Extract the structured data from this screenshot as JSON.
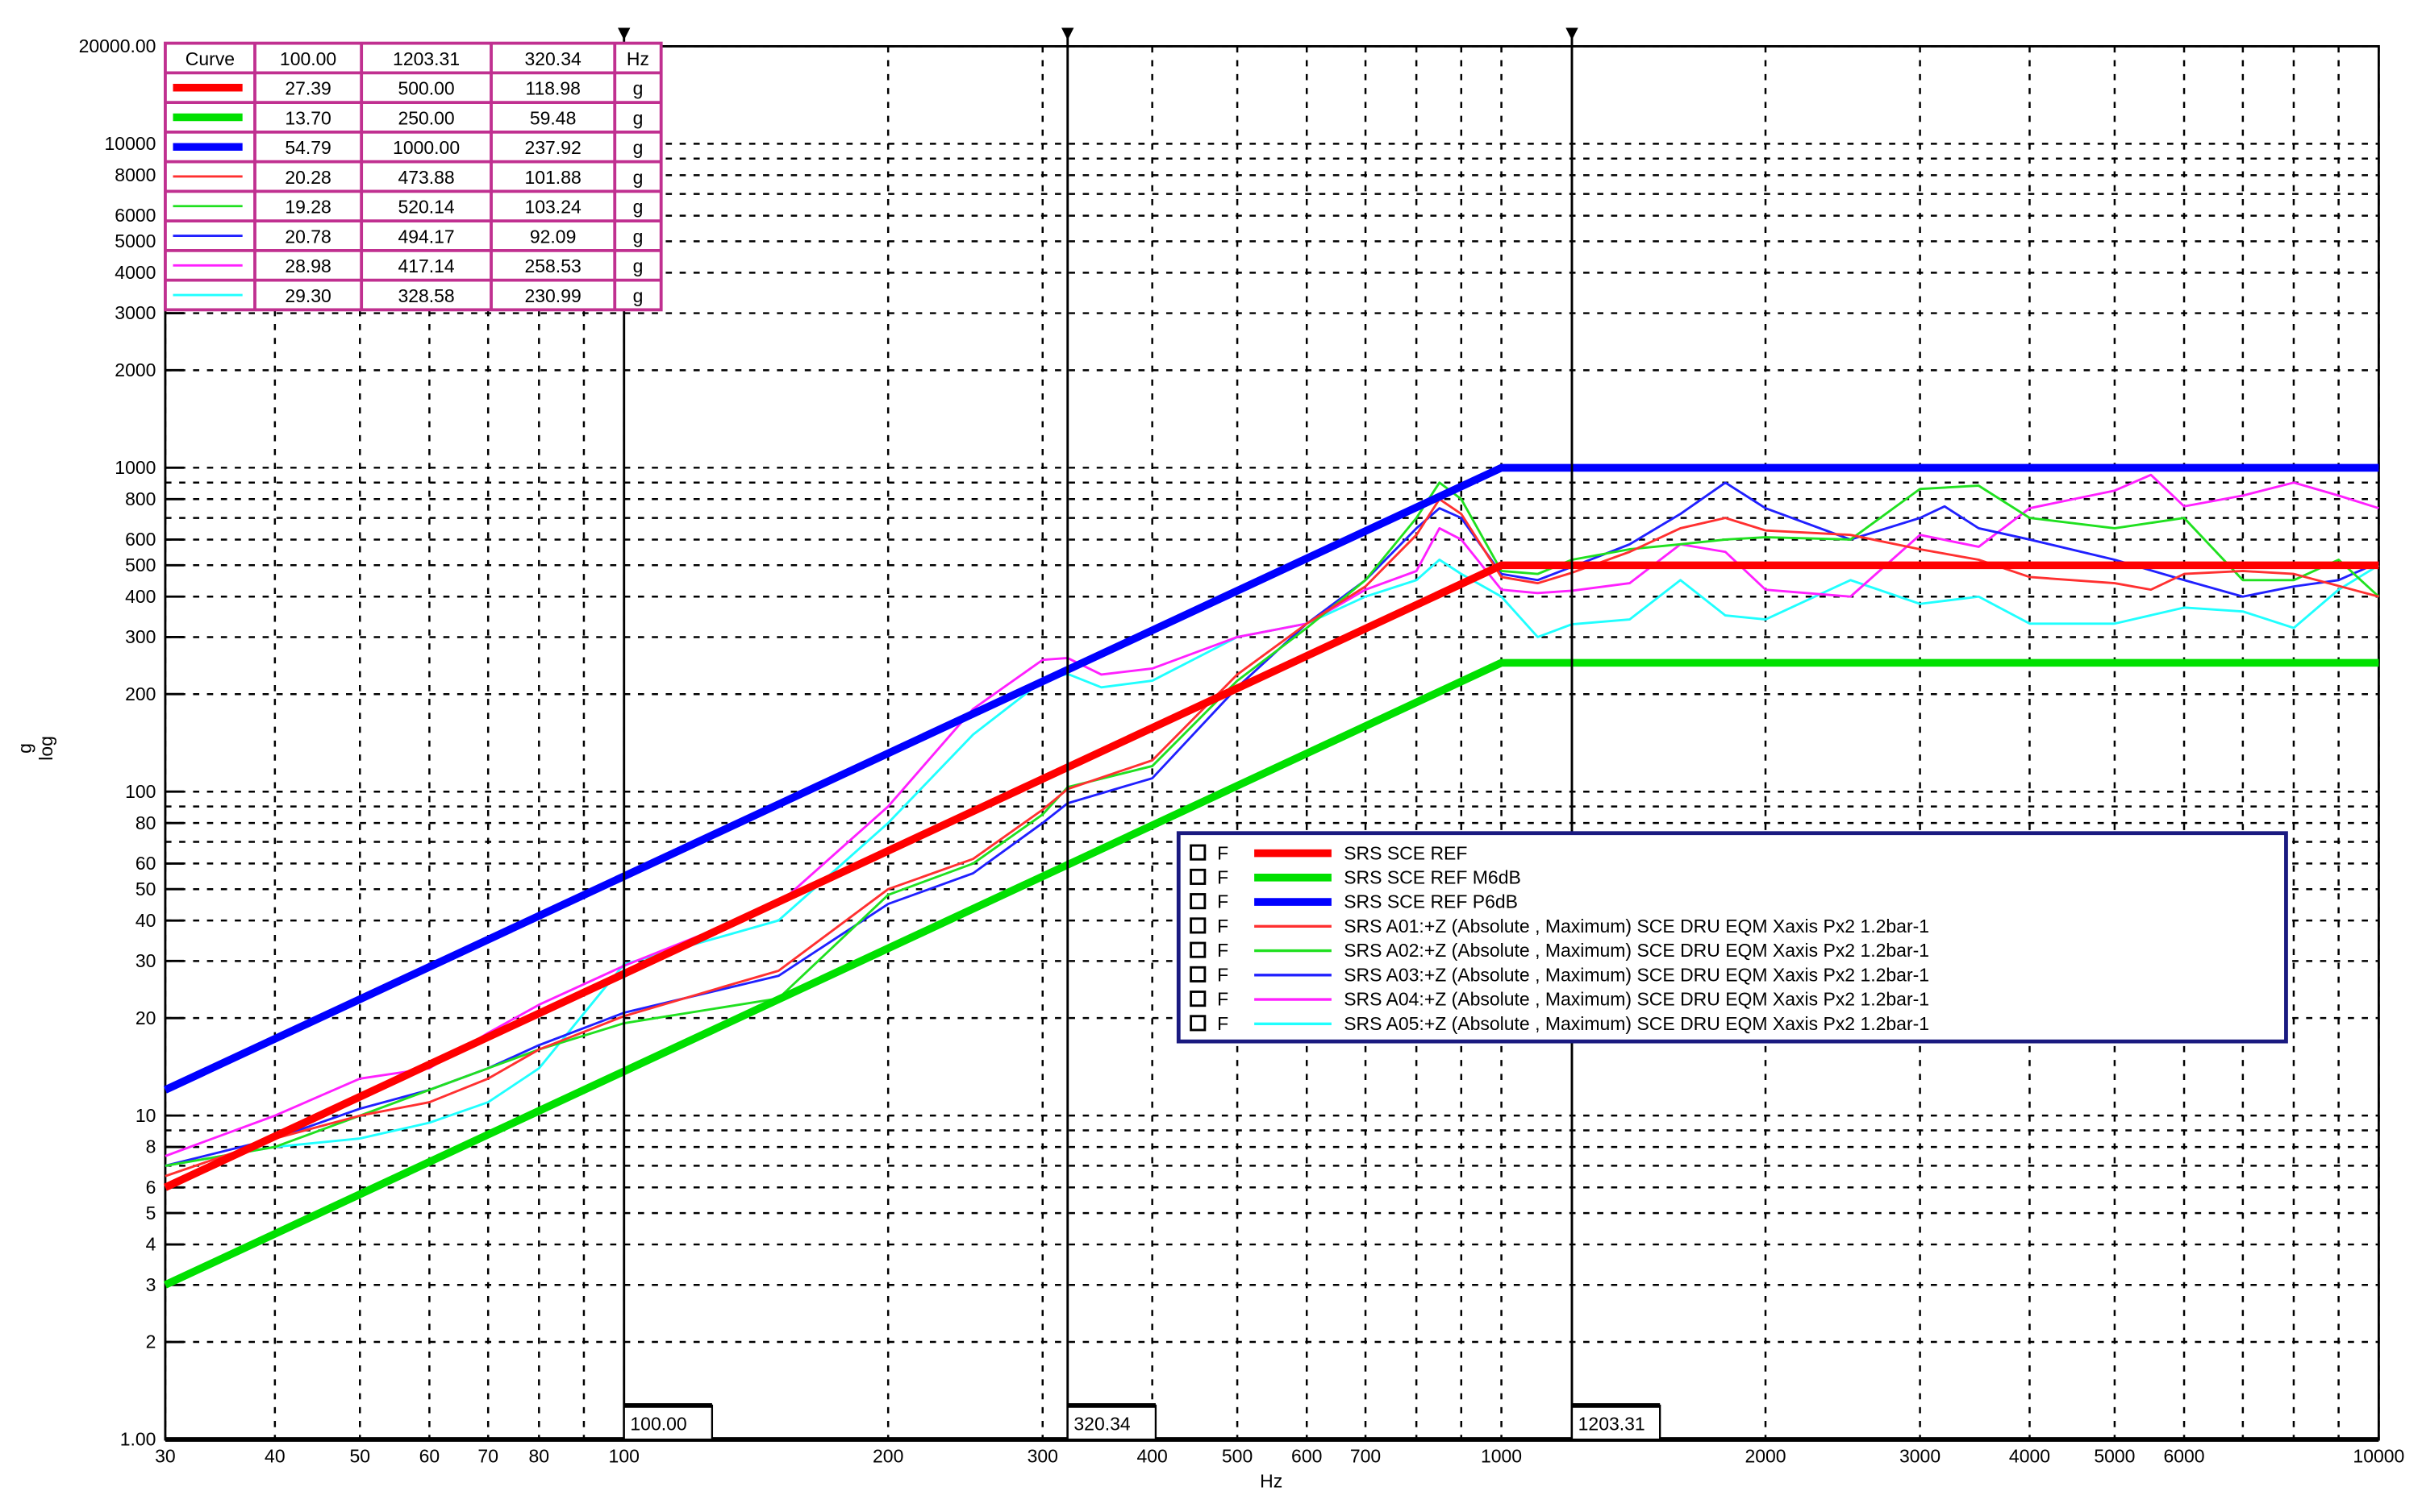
{
  "chart_data": {
    "type": "line",
    "xscale": "log",
    "yscale": "log",
    "xlim": [
      30,
      10000
    ],
    "ylim": [
      1,
      20000
    ],
    "xlabel": "Hz",
    "ylabel": "g",
    "ylabel_sub": "log",
    "grid": true,
    "x_ticks": [
      30,
      40,
      50,
      60,
      70,
      80,
      100,
      200,
      300,
      400,
      500,
      600,
      700,
      1000,
      2000,
      3000,
      4000,
      5000,
      6000,
      10000
    ],
    "x_tick_labels": [
      "30",
      "40",
      "50",
      "60",
      "70",
      "80",
      "100",
      "200",
      "300",
      "400",
      "500",
      "600",
      "700",
      "1000",
      "2000",
      "3000",
      "4000",
      "5000",
      "6000",
      "10000"
    ],
    "y_ticks": [
      1,
      2,
      3,
      4,
      5,
      6,
      8,
      10,
      20,
      30,
      40,
      50,
      60,
      80,
      100,
      200,
      300,
      400,
      500,
      600,
      800,
      1000,
      2000,
      3000,
      4000,
      5000,
      6000,
      8000,
      10000,
      20000
    ],
    "y_tick_labels": [
      "1.00",
      "2",
      "3",
      "4",
      "5",
      "6",
      "8",
      "10",
      "20",
      "30",
      "40",
      "50",
      "60",
      "80",
      "100",
      "200",
      "300",
      "400",
      "500",
      "600",
      "800",
      "1000",
      "2000",
      "3000",
      "4000",
      "5000",
      "6000",
      "8000",
      "10000",
      "20000.00"
    ],
    "cursors": [
      {
        "freq": 100.0,
        "label": "100.00"
      },
      {
        "freq": 320.34,
        "label": "320.34"
      },
      {
        "freq": 1203.31,
        "label": "1203.31"
      }
    ],
    "cursor_table": {
      "header": [
        "Curve",
        "100.00",
        "1203.31",
        "320.34",
        "Hz"
      ],
      "rows": [
        {
          "color": "#ff0000",
          "thick": true,
          "values": [
            "27.39",
            "500.00",
            "118.98"
          ],
          "unit": "g"
        },
        {
          "color": "#00e000",
          "thick": true,
          "values": [
            "13.70",
            "250.00",
            "59.48"
          ],
          "unit": "g"
        },
        {
          "color": "#0000ff",
          "thick": true,
          "values": [
            "54.79",
            "1000.00",
            "237.92"
          ],
          "unit": "g"
        },
        {
          "color": "#ff3030",
          "thick": false,
          "values": [
            "20.28",
            "473.88",
            "101.88"
          ],
          "unit": "g"
        },
        {
          "color": "#20e020",
          "thick": false,
          "values": [
            "19.28",
            "520.14",
            "103.24"
          ],
          "unit": "g"
        },
        {
          "color": "#2020ff",
          "thick": false,
          "values": [
            "20.78",
            "494.17",
            "92.09"
          ],
          "unit": "g"
        },
        {
          "color": "#ff20ff",
          "thick": false,
          "values": [
            "28.98",
            "417.14",
            "258.53"
          ],
          "unit": "g"
        },
        {
          "color": "#20ffff",
          "thick": false,
          "values": [
            "29.30",
            "328.58",
            "230.99"
          ],
          "unit": "g"
        }
      ]
    },
    "series": [
      {
        "name": "SRS  SCE REF",
        "flag": "F",
        "color": "#ff0000",
        "thick": true,
        "x": [
          30,
          1000,
          10000
        ],
        "y": [
          6.0,
          500,
          500
        ]
      },
      {
        "name": "SRS  SCE REF M6dB",
        "flag": "F",
        "color": "#00e000",
        "thick": true,
        "x": [
          30,
          1000,
          10000
        ],
        "y": [
          3.0,
          250,
          250
        ]
      },
      {
        "name": "SRS  SCE REF P6dB",
        "flag": "F",
        "color": "#0000ff",
        "thick": true,
        "x": [
          30,
          1000,
          10000
        ],
        "y": [
          12.0,
          1000,
          1000
        ]
      },
      {
        "name": "SRS  A01:+Z (Absolute , Maximum)  SCE DRU EQM Xaxis Px2 1.2bar-1",
        "flag": "F",
        "color": "#ff3030",
        "thick": false,
        "x": [
          30,
          40,
          50,
          60,
          70,
          80,
          100,
          130,
          150,
          200,
          250,
          300,
          320.34,
          400,
          500,
          600,
          700,
          800,
          850,
          900,
          1000,
          1100,
          1203.31,
          1400,
          1600,
          1800,
          2000,
          2500,
          3000,
          3500,
          4000,
          5000,
          5500,
          6000,
          7000,
          8000,
          10000
        ],
        "y": [
          6.5,
          8.5,
          10,
          11,
          13,
          16,
          20.28,
          25,
          28,
          50,
          62,
          88,
          101.88,
          125,
          230,
          330,
          430,
          620,
          800,
          720,
          460,
          440,
          473.88,
          550,
          650,
          700,
          640,
          620,
          560,
          520,
          460,
          440,
          420,
          470,
          480,
          470,
          400
        ]
      },
      {
        "name": "SRS  A02:+Z (Absolute , Maximum)  SCE DRU EQM Xaxis Px2 1.2bar-1",
        "flag": "F",
        "color": "#20e020",
        "thick": false,
        "x": [
          30,
          40,
          50,
          60,
          70,
          80,
          100,
          150,
          200,
          250,
          300,
          320.34,
          400,
          500,
          600,
          700,
          800,
          850,
          900,
          1000,
          1100,
          1203.31,
          1400,
          1600,
          1800,
          2000,
          2500,
          3000,
          3500,
          4000,
          5000,
          6000,
          7000,
          8000,
          9000,
          10000
        ],
        "y": [
          7,
          8,
          10,
          12,
          14,
          16,
          19.28,
          23,
          48,
          60,
          85,
          103.24,
          120,
          220,
          320,
          450,
          700,
          900,
          800,
          480,
          470,
          520.14,
          560,
          580,
          600,
          610,
          600,
          860,
          880,
          700,
          650,
          700,
          450,
          450,
          520,
          400
        ]
      },
      {
        "name": "SRS  A03:+Z (Absolute , Maximum)  SCE DRU EQM Xaxis Px2 1.2bar-1",
        "flag": "F",
        "color": "#2020ff",
        "thick": false,
        "x": [
          30,
          40,
          50,
          60,
          70,
          80,
          100,
          150,
          200,
          250,
          300,
          320.34,
          400,
          500,
          600,
          700,
          800,
          850,
          900,
          1000,
          1100,
          1203.31,
          1400,
          1600,
          1800,
          2000,
          2500,
          3000,
          3200,
          3500,
          4000,
          5000,
          6000,
          7000,
          8000,
          9000,
          10000
        ],
        "y": [
          7,
          8.5,
          10.5,
          12,
          14,
          16.5,
          20.78,
          27,
          45,
          56,
          80,
          92.09,
          110,
          210,
          330,
          450,
          650,
          750,
          700,
          470,
          450,
          494.17,
          580,
          720,
          900,
          750,
          600,
          700,
          760,
          650,
          600,
          520,
          450,
          400,
          430,
          450,
          510
        ]
      },
      {
        "name": "SRS  A04:+Z (Absolute , Maximum)  SCE DRU EQM Xaxis Px2 1.2bar-1",
        "flag": "F",
        "color": "#ff20ff",
        "thick": false,
        "x": [
          30,
          40,
          50,
          60,
          70,
          80,
          100,
          150,
          200,
          250,
          300,
          320.34,
          350,
          400,
          500,
          600,
          700,
          800,
          850,
          900,
          1000,
          1100,
          1203.31,
          1400,
          1600,
          1800,
          2000,
          2500,
          3000,
          3500,
          4000,
          5000,
          5500,
          6000,
          7000,
          8000,
          9000,
          10000
        ],
        "y": [
          7.5,
          10,
          13,
          14,
          18,
          22,
          28.98,
          45,
          90,
          180,
          255,
          258.53,
          230,
          240,
          300,
          330,
          420,
          480,
          650,
          600,
          420,
          410,
          417.14,
          440,
          580,
          550,
          420,
          400,
          620,
          570,
          750,
          850,
          950,
          760,
          820,
          900,
          820,
          750
        ]
      },
      {
        "name": "SRS  A05:+Z (Absolute , Maximum)  SCE DRU EQM Xaxis Px2 1.2bar-1",
        "flag": "F",
        "color": "#20ffff",
        "thick": false,
        "x": [
          30,
          40,
          50,
          60,
          70,
          80,
          100,
          150,
          200,
          250,
          300,
          320.34,
          350,
          400,
          500,
          600,
          700,
          800,
          850,
          900,
          1000,
          1100,
          1203.31,
          1400,
          1600,
          1800,
          2000,
          2500,
          3000,
          3500,
          4000,
          5000,
          6000,
          7000,
          8000,
          9000,
          10000
        ],
        "y": [
          7,
          8,
          8.5,
          9.5,
          11,
          14,
          29.3,
          40,
          80,
          150,
          220,
          230.99,
          210,
          220,
          300,
          330,
          400,
          450,
          520,
          470,
          400,
          300,
          328.58,
          340,
          450,
          350,
          340,
          450,
          380,
          400,
          330,
          330,
          370,
          360,
          320,
          420,
          500
        ]
      }
    ]
  }
}
